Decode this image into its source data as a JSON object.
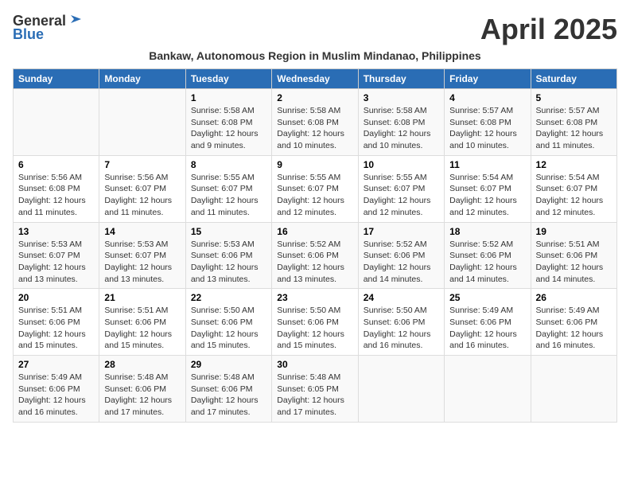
{
  "header": {
    "logo_general": "General",
    "logo_blue": "Blue",
    "title": "April 2025",
    "subtitle": "Bankaw, Autonomous Region in Muslim Mindanao, Philippines"
  },
  "days_of_week": [
    "Sunday",
    "Monday",
    "Tuesday",
    "Wednesday",
    "Thursday",
    "Friday",
    "Saturday"
  ],
  "weeks": [
    [
      {
        "num": "",
        "info": ""
      },
      {
        "num": "",
        "info": ""
      },
      {
        "num": "1",
        "info": "Sunrise: 5:58 AM\nSunset: 6:08 PM\nDaylight: 12 hours and 9 minutes."
      },
      {
        "num": "2",
        "info": "Sunrise: 5:58 AM\nSunset: 6:08 PM\nDaylight: 12 hours and 10 minutes."
      },
      {
        "num": "3",
        "info": "Sunrise: 5:58 AM\nSunset: 6:08 PM\nDaylight: 12 hours and 10 minutes."
      },
      {
        "num": "4",
        "info": "Sunrise: 5:57 AM\nSunset: 6:08 PM\nDaylight: 12 hours and 10 minutes."
      },
      {
        "num": "5",
        "info": "Sunrise: 5:57 AM\nSunset: 6:08 PM\nDaylight: 12 hours and 11 minutes."
      }
    ],
    [
      {
        "num": "6",
        "info": "Sunrise: 5:56 AM\nSunset: 6:08 PM\nDaylight: 12 hours and 11 minutes."
      },
      {
        "num": "7",
        "info": "Sunrise: 5:56 AM\nSunset: 6:07 PM\nDaylight: 12 hours and 11 minutes."
      },
      {
        "num": "8",
        "info": "Sunrise: 5:55 AM\nSunset: 6:07 PM\nDaylight: 12 hours and 11 minutes."
      },
      {
        "num": "9",
        "info": "Sunrise: 5:55 AM\nSunset: 6:07 PM\nDaylight: 12 hours and 12 minutes."
      },
      {
        "num": "10",
        "info": "Sunrise: 5:55 AM\nSunset: 6:07 PM\nDaylight: 12 hours and 12 minutes."
      },
      {
        "num": "11",
        "info": "Sunrise: 5:54 AM\nSunset: 6:07 PM\nDaylight: 12 hours and 12 minutes."
      },
      {
        "num": "12",
        "info": "Sunrise: 5:54 AM\nSunset: 6:07 PM\nDaylight: 12 hours and 12 minutes."
      }
    ],
    [
      {
        "num": "13",
        "info": "Sunrise: 5:53 AM\nSunset: 6:07 PM\nDaylight: 12 hours and 13 minutes."
      },
      {
        "num": "14",
        "info": "Sunrise: 5:53 AM\nSunset: 6:07 PM\nDaylight: 12 hours and 13 minutes."
      },
      {
        "num": "15",
        "info": "Sunrise: 5:53 AM\nSunset: 6:06 PM\nDaylight: 12 hours and 13 minutes."
      },
      {
        "num": "16",
        "info": "Sunrise: 5:52 AM\nSunset: 6:06 PM\nDaylight: 12 hours and 13 minutes."
      },
      {
        "num": "17",
        "info": "Sunrise: 5:52 AM\nSunset: 6:06 PM\nDaylight: 12 hours and 14 minutes."
      },
      {
        "num": "18",
        "info": "Sunrise: 5:52 AM\nSunset: 6:06 PM\nDaylight: 12 hours and 14 minutes."
      },
      {
        "num": "19",
        "info": "Sunrise: 5:51 AM\nSunset: 6:06 PM\nDaylight: 12 hours and 14 minutes."
      }
    ],
    [
      {
        "num": "20",
        "info": "Sunrise: 5:51 AM\nSunset: 6:06 PM\nDaylight: 12 hours and 15 minutes."
      },
      {
        "num": "21",
        "info": "Sunrise: 5:51 AM\nSunset: 6:06 PM\nDaylight: 12 hours and 15 minutes."
      },
      {
        "num": "22",
        "info": "Sunrise: 5:50 AM\nSunset: 6:06 PM\nDaylight: 12 hours and 15 minutes."
      },
      {
        "num": "23",
        "info": "Sunrise: 5:50 AM\nSunset: 6:06 PM\nDaylight: 12 hours and 15 minutes."
      },
      {
        "num": "24",
        "info": "Sunrise: 5:50 AM\nSunset: 6:06 PM\nDaylight: 12 hours and 16 minutes."
      },
      {
        "num": "25",
        "info": "Sunrise: 5:49 AM\nSunset: 6:06 PM\nDaylight: 12 hours and 16 minutes."
      },
      {
        "num": "26",
        "info": "Sunrise: 5:49 AM\nSunset: 6:06 PM\nDaylight: 12 hours and 16 minutes."
      }
    ],
    [
      {
        "num": "27",
        "info": "Sunrise: 5:49 AM\nSunset: 6:06 PM\nDaylight: 12 hours and 16 minutes."
      },
      {
        "num": "28",
        "info": "Sunrise: 5:48 AM\nSunset: 6:06 PM\nDaylight: 12 hours and 17 minutes."
      },
      {
        "num": "29",
        "info": "Sunrise: 5:48 AM\nSunset: 6:06 PM\nDaylight: 12 hours and 17 minutes."
      },
      {
        "num": "30",
        "info": "Sunrise: 5:48 AM\nSunset: 6:05 PM\nDaylight: 12 hours and 17 minutes."
      },
      {
        "num": "",
        "info": ""
      },
      {
        "num": "",
        "info": ""
      },
      {
        "num": "",
        "info": ""
      }
    ]
  ]
}
